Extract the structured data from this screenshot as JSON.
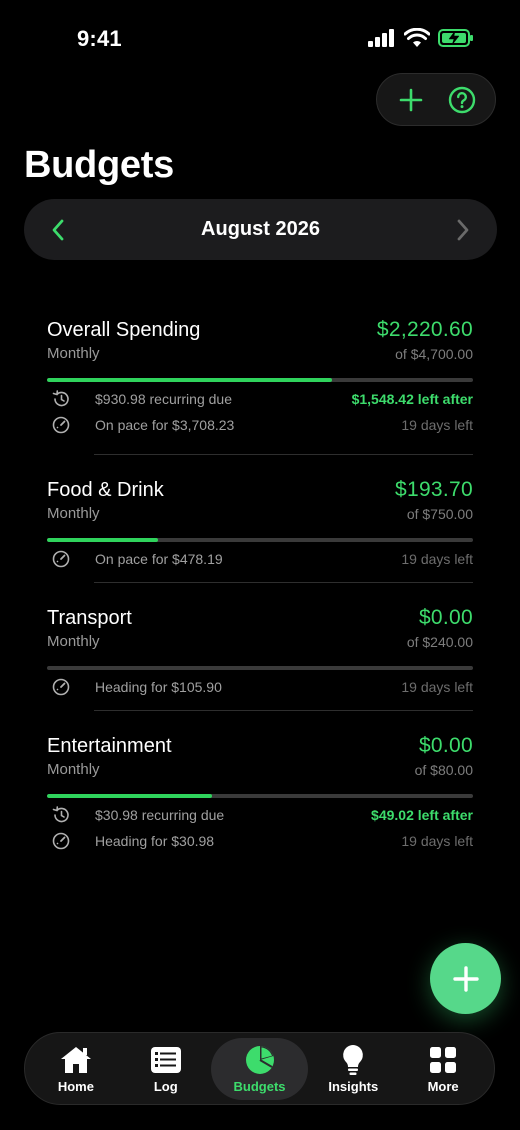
{
  "status_bar": {
    "time": "9:41"
  },
  "top_actions": {
    "add_icon": "plus-icon",
    "help_icon": "question-circle-icon"
  },
  "page": {
    "title": "Budgets"
  },
  "month_selector": {
    "label": "August 2026"
  },
  "colors": {
    "accent": "#3ddc6c",
    "bar_fill": "#2fd35c",
    "fab": "#56d88a",
    "background": "#000000"
  },
  "budgets": [
    {
      "name": "Overall Spending",
      "period": "Monthly",
      "amount": "$2,220.60",
      "of": "of $4,700.00",
      "progress": 0.67,
      "rows": [
        {
          "icon": "history-icon",
          "text": "$930.98 recurring due",
          "right": "$1,548.42 left after",
          "right_green": true
        },
        {
          "icon": "gauge-icon",
          "text": "On pace for $3,708.23",
          "right": "19 days left",
          "right_green": false
        }
      ]
    },
    {
      "name": "Food & Drink",
      "period": "Monthly",
      "amount": "$193.70",
      "of": "of $750.00",
      "progress": 0.26,
      "rows": [
        {
          "icon": "gauge-icon",
          "text": "On pace for $478.19",
          "right": "19 days left",
          "right_green": false
        }
      ]
    },
    {
      "name": "Transport",
      "period": "Monthly",
      "amount": "$0.00",
      "of": "of $240.00",
      "progress": 0.0,
      "rows": [
        {
          "icon": "gauge-icon",
          "text": "Heading for $105.90",
          "right": "19 days left",
          "right_green": false
        }
      ]
    },
    {
      "name": "Entertainment",
      "period": "Monthly",
      "amount": "$0.00",
      "of": "of $80.00",
      "progress": 0.387,
      "rows": [
        {
          "icon": "history-icon",
          "text": "$30.98 recurring due",
          "right": "$49.02 left after",
          "right_green": true
        },
        {
          "icon": "gauge-icon",
          "text": "Heading for $30.98",
          "right": "19 days left",
          "right_green": false
        }
      ]
    }
  ],
  "tab_bar": {
    "tabs": [
      {
        "label": "Home",
        "icon": "home-icon",
        "active": false
      },
      {
        "label": "Log",
        "icon": "list-icon",
        "active": false
      },
      {
        "label": "Budgets",
        "icon": "pie-chart-icon",
        "active": true
      },
      {
        "label": "Insights",
        "icon": "lightbulb-icon",
        "active": false
      },
      {
        "label": "More",
        "icon": "grid-icon",
        "active": false
      }
    ]
  }
}
